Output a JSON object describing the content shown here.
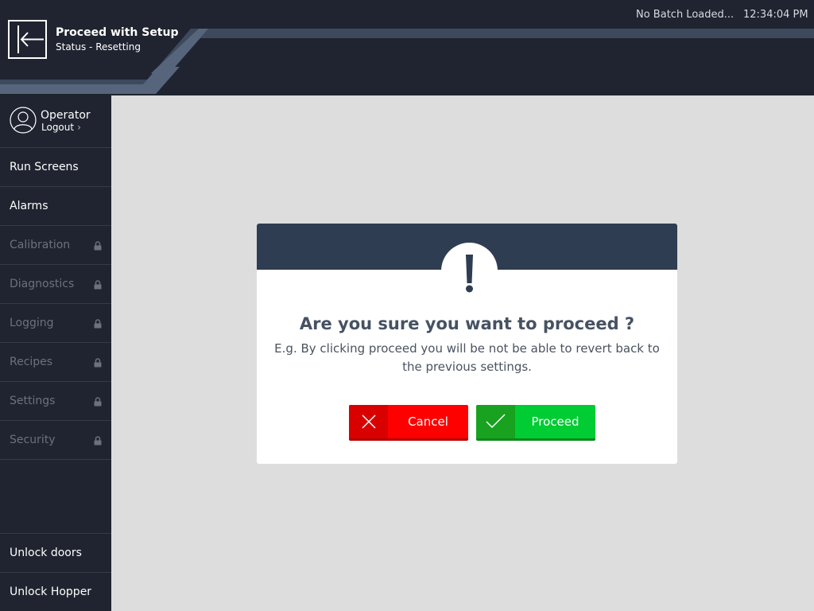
{
  "header": {
    "title": "Proceed with Setup",
    "subtitle": "Status - Resetting",
    "batch_status": "No Batch Loaded...",
    "time": "12:34:04 PM"
  },
  "sidebar": {
    "user": {
      "name": "Operator",
      "logout_label": "Logout"
    },
    "items": [
      {
        "label": "Run Screens",
        "locked": false
      },
      {
        "label": "Alarms",
        "locked": false
      },
      {
        "label": "Calibration",
        "locked": true
      },
      {
        "label": "Diagnostics",
        "locked": true
      },
      {
        "label": "Logging",
        "locked": true
      },
      {
        "label": "Recipes",
        "locked": true
      },
      {
        "label": "Settings",
        "locked": true
      },
      {
        "label": "Security",
        "locked": true
      }
    ],
    "bottom_items": [
      {
        "label": "Unlock doors"
      },
      {
        "label": "Unlock Hopper"
      }
    ]
  },
  "dialog": {
    "title": "Are you sure you want to proceed ?",
    "message": "E.g. By clicking proceed you will be not be able to revert back to the previous settings.",
    "cancel_label": "Cancel",
    "proceed_label": "Proceed"
  },
  "colors": {
    "header_bg": "#1f2430",
    "content_bg": "#dddddd",
    "dialog_band": "#2e3d52",
    "cancel": "#ff0000",
    "proceed": "#00cc33",
    "locked_text": "#6c717c"
  },
  "icons": {
    "back": "arrow-left-icon",
    "avatar": "user-avatar-icon",
    "lock": "lock-icon",
    "alert": "exclamation-icon",
    "cancel": "x-icon",
    "proceed": "check-icon"
  }
}
